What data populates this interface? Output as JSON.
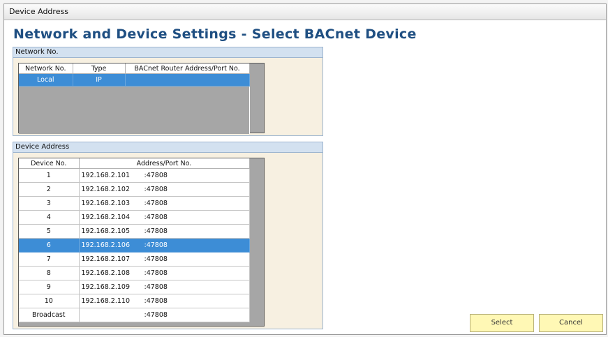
{
  "window": {
    "title": "Device Address"
  },
  "page_title": "Network and Device Settings - Select BACnet Device",
  "network_group": {
    "title": "Network No.",
    "columns": [
      "Network No.",
      "Type",
      "BACnet Router Address/Port No."
    ],
    "rows": [
      {
        "network": "Local",
        "type": "IP",
        "router": "",
        "selected": true
      }
    ]
  },
  "device_group": {
    "title": "Device Address",
    "columns": [
      "Device No.",
      "Address/Port No."
    ],
    "rows": [
      {
        "no": "1",
        "address": "192.168.2.101",
        "port": ":47808"
      },
      {
        "no": "2",
        "address": "192.168.2.102",
        "port": ":47808"
      },
      {
        "no": "3",
        "address": "192.168.2.103",
        "port": ":47808"
      },
      {
        "no": "4",
        "address": "192.168.2.104",
        "port": ":47808"
      },
      {
        "no": "5",
        "address": "192.168.2.105",
        "port": ":47808"
      },
      {
        "no": "6",
        "address": "192.168.2.106",
        "port": ":47808",
        "selected": true
      },
      {
        "no": "7",
        "address": "192.168.2.107",
        "port": ":47808"
      },
      {
        "no": "8",
        "address": "192.168.2.108",
        "port": ":47808"
      },
      {
        "no": "9",
        "address": "192.168.2.109",
        "port": ":47808"
      },
      {
        "no": "10",
        "address": "192.168.2.110",
        "port": ":47808"
      },
      {
        "no": "Broadcast",
        "address": "",
        "port": ":47808"
      }
    ]
  },
  "buttons": {
    "select": "Select",
    "cancel": "Cancel"
  },
  "colors": {
    "title": "#1f4f82",
    "selection": "#3d8dd6",
    "group_background": "#f7f0e1",
    "group_header": "#d3e1f0",
    "button": "#fff8b5"
  }
}
